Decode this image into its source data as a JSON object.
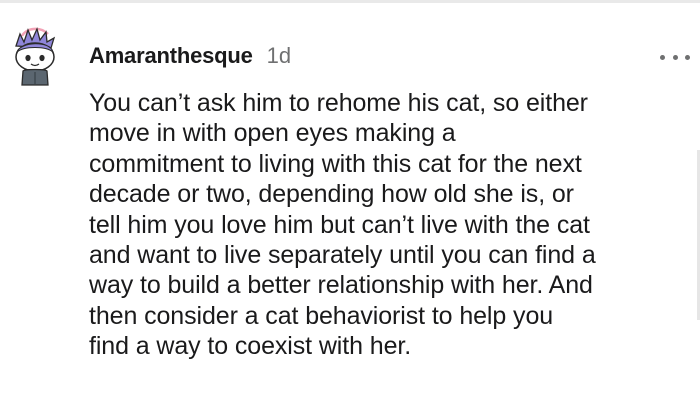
{
  "comment": {
    "author": "Amaranthesque",
    "timestamp": "1d",
    "avatar_icon": "snoo-avatar-icon",
    "more_icon": "more-options-icon",
    "body": "You can’t ask him to rehome his cat, so either\nmove in with open eyes making a\ncommitment to living with this cat for the next\ndecade or two, depending how old she is, or\ntell him you love him but can’t live with the cat\nand want to live separately until you can find a\nway to build a better relationship with her. And\nthen consider a cat behaviorist to help you\nfind a way to coexist with her."
  },
  "colors": {
    "text": "#1a1a1b",
    "muted": "#6f7071",
    "avatar_hair": "#8f86d9",
    "avatar_shirt": "#5b6670"
  }
}
